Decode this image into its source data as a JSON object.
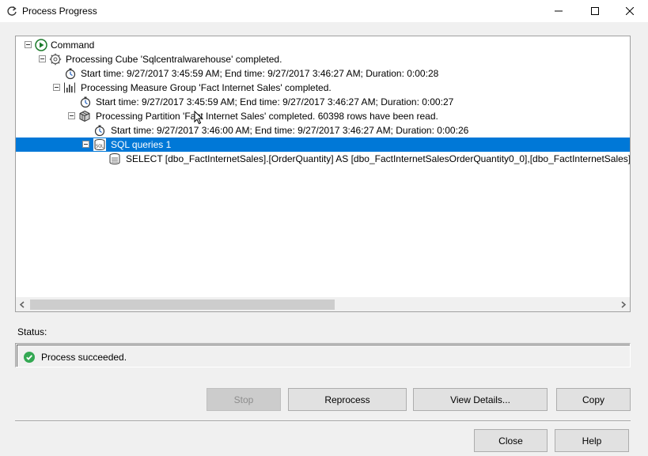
{
  "window": {
    "title": "Process Progress",
    "controls": {
      "minimize": "minimize",
      "maximize": "maximize",
      "close": "close"
    }
  },
  "tree": {
    "rows": [
      {
        "label": "Command",
        "icon": "play-icon"
      },
      {
        "label": "Processing Cube 'Sqlcentralwarehouse' completed.",
        "icon": "cube-gear-icon"
      },
      {
        "label": "Start time: 9/27/2017 3:45:59 AM; End time: 9/27/2017 3:46:27 AM; Duration: 0:00:28",
        "icon": "stopwatch-icon"
      },
      {
        "label": "Processing Measure Group 'Fact Internet Sales' completed.",
        "icon": "bar-chart-icon"
      },
      {
        "label": "Start time: 9/27/2017 3:45:59 AM; End time: 9/27/2017 3:46:27 AM; Duration: 0:00:27",
        "icon": "stopwatch-icon"
      },
      {
        "label": "Processing Partition 'Fact Internet Sales' completed. 60398 rows have been read.",
        "icon": "partition-cube-icon"
      },
      {
        "label": "Start time: 9/27/2017 3:46:00 AM; End time: 9/27/2017 3:46:27 AM; Duration: 0:00:26",
        "icon": "stopwatch-icon"
      },
      {
        "label": "SQL queries 1",
        "icon": "sql-database-icon"
      },
      {
        "label": "SELECT [dbo_FactInternetSales].[OrderQuantity] AS [dbo_FactInternetSalesOrderQuantity0_0],[dbo_FactInternetSales].[Un",
        "icon": "sql-query-icon"
      }
    ]
  },
  "status": {
    "label": "Status:",
    "message": "Process succeeded.",
    "icon": "check-circle-icon",
    "color": "#34a853"
  },
  "buttons": {
    "stop": "Stop",
    "reprocess": "Reprocess",
    "view_details": "View Details...",
    "copy": "Copy",
    "close": "Close",
    "help": "Help"
  },
  "colors": {
    "selection": "#0078d7",
    "panel_border": "#a0a0a0"
  }
}
